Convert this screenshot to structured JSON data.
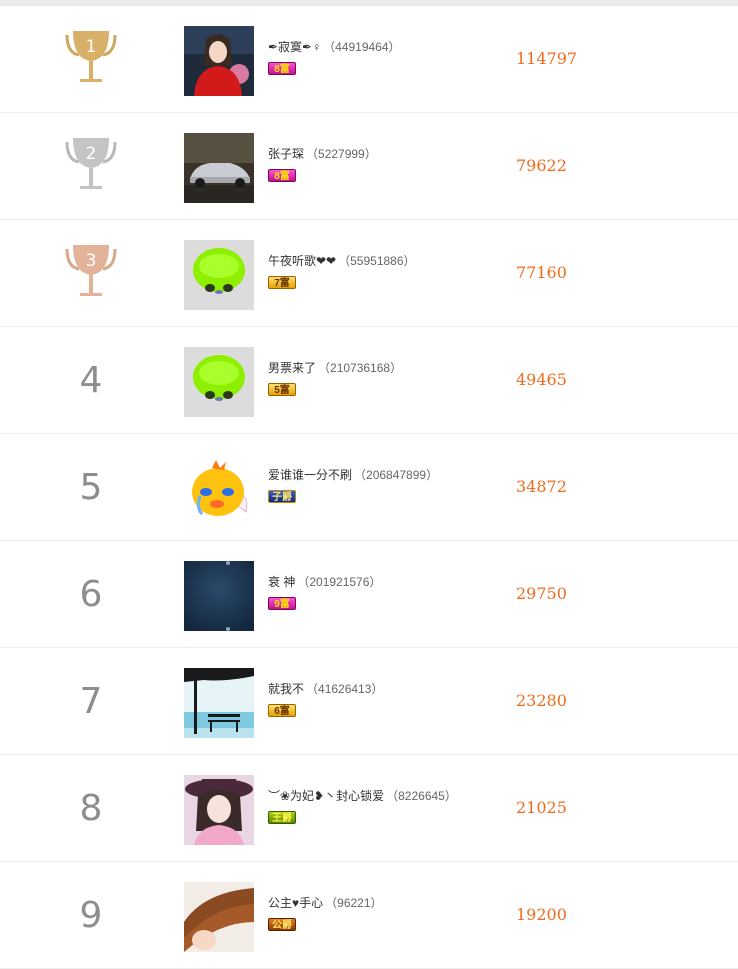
{
  "accent_color": "#f06a1b",
  "rows": [
    {
      "rank": "1",
      "name": "✒寂寞✒♀",
      "uid": "（44919464）",
      "badge": "8富",
      "score": "114797",
      "trophy": "gold-trophy-icon",
      "avatar": "woman-red-coat-avatar",
      "badge_color": "pink"
    },
    {
      "rank": "2",
      "name": "张子琛",
      "uid": "（5227999）",
      "badge": "8富",
      "score": "79622",
      "trophy": "silver-trophy-icon",
      "avatar": "silver-car-avatar",
      "badge_color": "pink"
    },
    {
      "rank": "3",
      "name": "午夜听歌❤❤",
      "uid": "（55951886）",
      "badge": "7富",
      "score": "77160",
      "trophy": "bronze-trophy-icon",
      "avatar": "green-alien-avatar",
      "badge_color": "gold"
    },
    {
      "rank": "4",
      "name": "男票来了",
      "uid": "（210736168）",
      "badge": "5富",
      "score": "49465",
      "avatar": "green-alien-avatar",
      "badge_color": "gold"
    },
    {
      "rank": "5",
      "name": "爱谁谁一分不刷",
      "uid": "（206847899）",
      "badge": "子爵",
      "score": "34872",
      "avatar": "crying-chick-avatar",
      "badge_color": "blue"
    },
    {
      "rank": "6",
      "name": "衰 神",
      "uid": "（201921576）",
      "badge": "9富",
      "score": "29750",
      "avatar": "dark-blue-avatar",
      "badge_color": "pink"
    },
    {
      "rank": "7",
      "name": "就我不",
      "uid": "（41626413）",
      "badge": "6富",
      "score": "23280",
      "avatar": "tree-bench-avatar",
      "badge_color": "gold"
    },
    {
      "rank": "8",
      "name": "︶❀为妃❥丶封心锁爱",
      "uid": "（8226645）",
      "badge": "王爵",
      "score": "21025",
      "avatar": "woman-hat-avatar",
      "badge_color": "green"
    },
    {
      "rank": "9",
      "name": "公主♥手心",
      "uid": "（96221）",
      "badge": "公爵",
      "score": "19200",
      "avatar": "flowing-hair-avatar",
      "badge_color": "brown"
    }
  ]
}
